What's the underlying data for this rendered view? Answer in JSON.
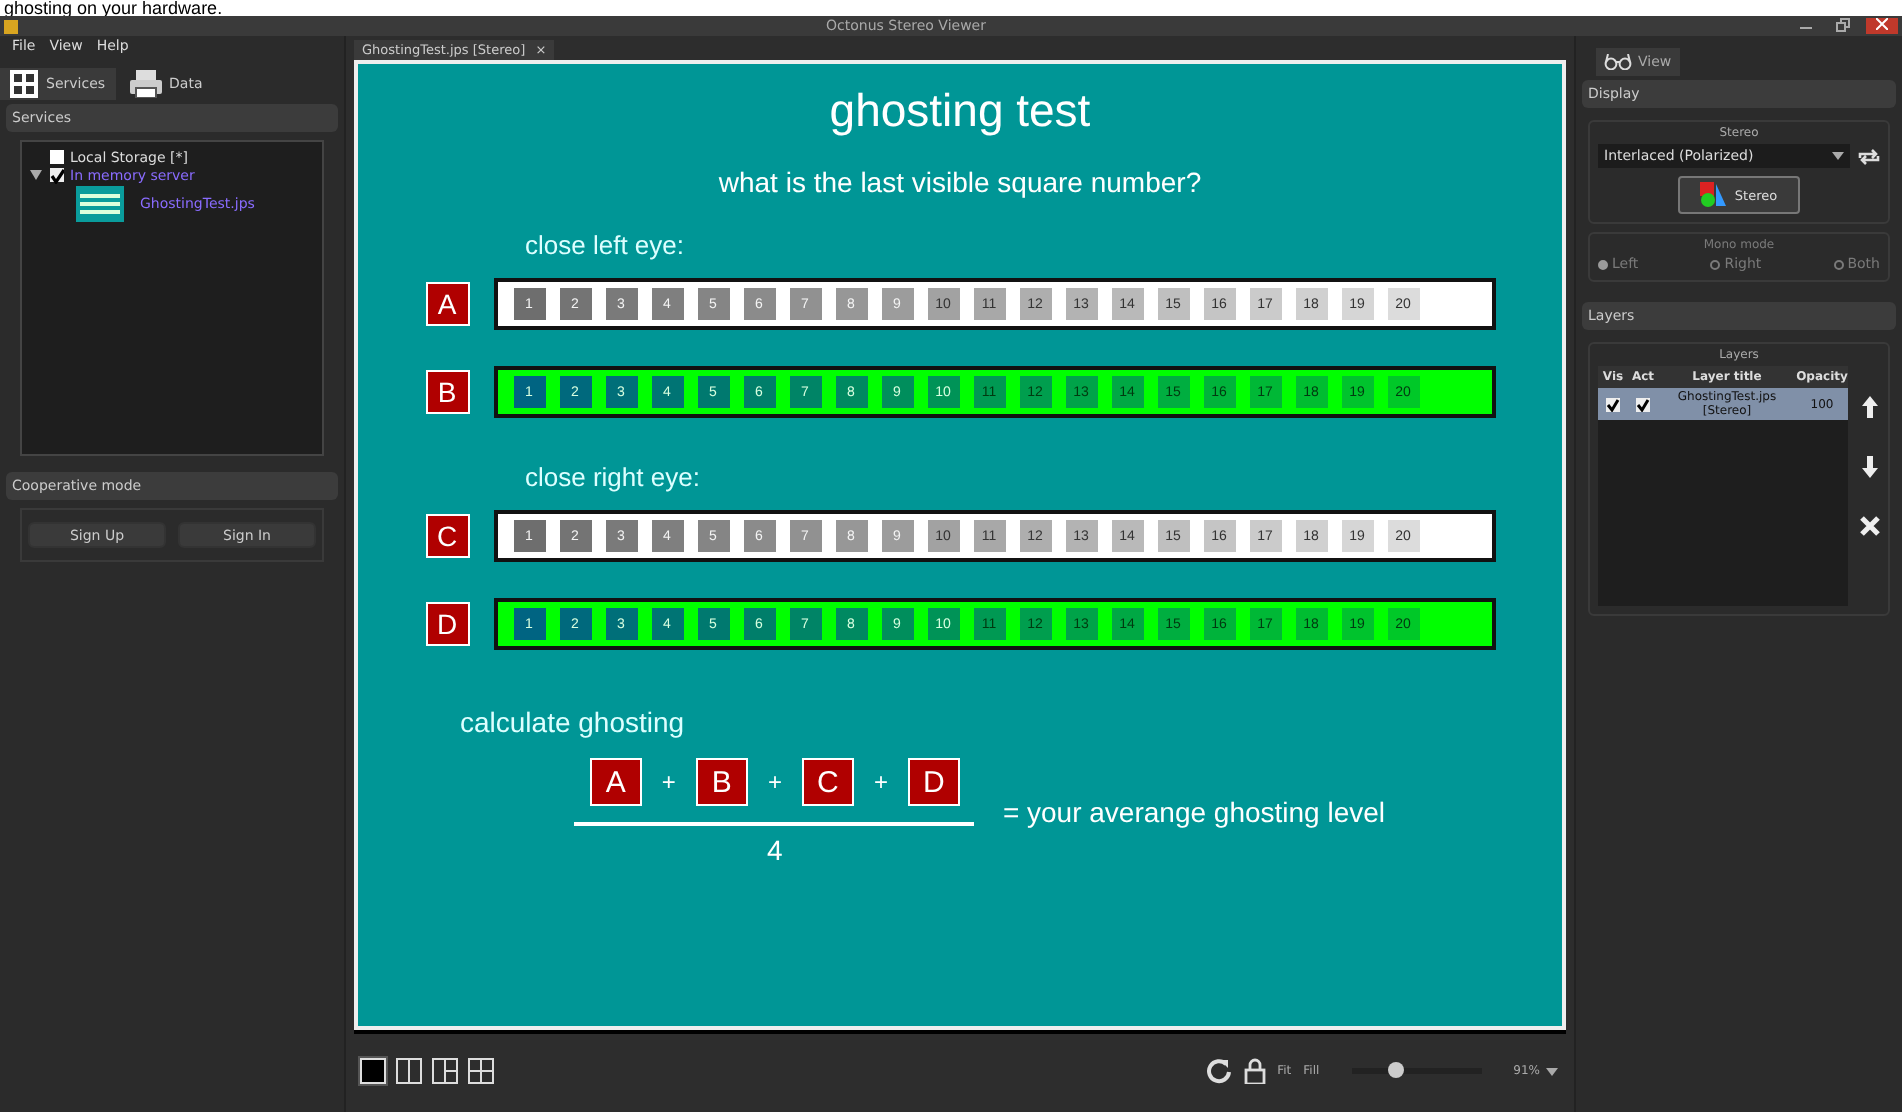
{
  "caption": "ghosting on your hardware.",
  "window": {
    "title": "Octonus Stereo Viewer"
  },
  "menu": [
    "File",
    "View",
    "Help"
  ],
  "left_tabs": [
    {
      "label": "Services",
      "selected": true
    },
    {
      "label": "Data",
      "selected": false
    }
  ],
  "services": {
    "title": "Services",
    "tree": [
      {
        "label": "Local Storage [*]",
        "checked": false,
        "expanded": false
      },
      {
        "label": "In memory server",
        "checked": true,
        "expanded": true,
        "children": [
          {
            "label": "GhostingTest.jps"
          }
        ]
      }
    ]
  },
  "cooperative": {
    "title": "Cooperative mode",
    "buttons": [
      "Sign Up",
      "Sign In"
    ]
  },
  "doc_tab": {
    "label": "GhostingTest.jps [Stereo]",
    "close": "×"
  },
  "slide": {
    "title": "ghosting test",
    "question": "what is the last visible square number?",
    "groups": [
      {
        "heading": "close left eye:",
        "bars": [
          {
            "letter": "A",
            "kind": "white",
            "squares": [
              "1",
              "2",
              "3",
              "4",
              "5",
              "6",
              "7",
              "8",
              "9",
              "10",
              "11",
              "12",
              "13",
              "14",
              "15",
              "16",
              "17",
              "18",
              "19",
              "20"
            ]
          },
          {
            "letter": "B",
            "kind": "green",
            "squares": [
              "1",
              "2",
              "3",
              "4",
              "5",
              "6",
              "7",
              "8",
              "9",
              "10",
              "11",
              "12",
              "13",
              "14",
              "15",
              "16",
              "17",
              "18",
              "19",
              "20"
            ]
          }
        ]
      },
      {
        "heading": "close right eye:",
        "bars": [
          {
            "letter": "C",
            "kind": "white",
            "squares": [
              "1",
              "2",
              "3",
              "4",
              "5",
              "6",
              "7",
              "8",
              "9",
              "10",
              "11",
              "12",
              "13",
              "14",
              "15",
              "16",
              "17",
              "18",
              "19",
              "20"
            ]
          },
          {
            "letter": "D",
            "kind": "green",
            "squares": [
              "1",
              "2",
              "3",
              "4",
              "5",
              "6",
              "7",
              "8",
              "9",
              "10",
              "11",
              "12",
              "13",
              "14",
              "15",
              "16",
              "17",
              "18",
              "19",
              "20"
            ]
          }
        ]
      }
    ],
    "calc_heading": "calculate ghosting",
    "formula": {
      "terms": [
        "A",
        "B",
        "C",
        "D"
      ],
      "operator": "+",
      "denominator": "4",
      "result": "= your averange ghosting level"
    }
  },
  "bottom": {
    "layouts": [
      {
        "selected": true
      },
      {
        "selected": false
      },
      {
        "selected": false
      },
      {
        "selected": false
      }
    ],
    "fit": "Fit",
    "fill": "Fill",
    "zoom": {
      "level": 0.35
    },
    "zoom_reading": "91%"
  },
  "right_tabs": [
    {
      "label": "View",
      "selected": true
    }
  ],
  "display": {
    "title": "Display",
    "stereo_group": "Stereo",
    "mode": "Interlaced (Polarized)",
    "stereo_button": "Stereo",
    "mono_group": "Mono mode",
    "mono_disabled": true,
    "mono": [
      {
        "label": "Left",
        "selected": true
      },
      {
        "label": "Right",
        "selected": false
      },
      {
        "label": "Both",
        "selected": false
      }
    ]
  },
  "layers": {
    "title": "Layers",
    "group": "Layers",
    "columns": [
      "Vis",
      "Act",
      "Layer title",
      "Opacity"
    ],
    "rows": [
      {
        "visible": true,
        "active": true,
        "title": "GhostingTest.jps [Stereo]",
        "opacity": "100",
        "selected": true
      }
    ]
  }
}
